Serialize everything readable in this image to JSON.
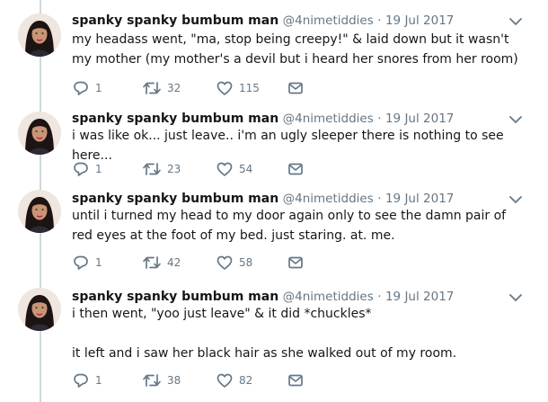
{
  "account": {
    "name": "spanky spanky bumbum man",
    "handle": "@4nimetiddies",
    "separator": "·"
  },
  "tweets": [
    {
      "date": "19 Jul 2017",
      "text": "my headass went, \"ma, stop being creepy!\" & laid down but it wasn't my mother (my mother's a devil but i heard her snores from her room)",
      "replies": "1",
      "retweets": "32",
      "likes": "115"
    },
    {
      "date": "19 Jul 2017",
      "text": "i was like ok... just leave.. i'm an ugly sleeper there is nothing to see here...",
      "replies": "1",
      "retweets": "23",
      "likes": "54"
    },
    {
      "date": "19 Jul 2017",
      "text": "until i turned my head to my door again only to see the damn pair of red eyes at the foot of my bed. just staring. at. me.",
      "replies": "1",
      "retweets": "42",
      "likes": "58"
    },
    {
      "date": "19 Jul 2017",
      "text": "i then went, \"yoo just leave\" & it did *chuckles*\n\nit left and i saw her black hair as she walked out of my room.",
      "replies": "1",
      "retweets": "38",
      "likes": "82"
    }
  ],
  "icons": {
    "reply": "reply-icon",
    "retweet": "retweet-icon",
    "like": "heart-icon",
    "dm": "envelope-icon",
    "menu": "chevron-down-icon"
  },
  "colors": {
    "text": "#14171a",
    "muted": "#657786",
    "icon": "#657786",
    "thread_line": "#cfd8de"
  }
}
